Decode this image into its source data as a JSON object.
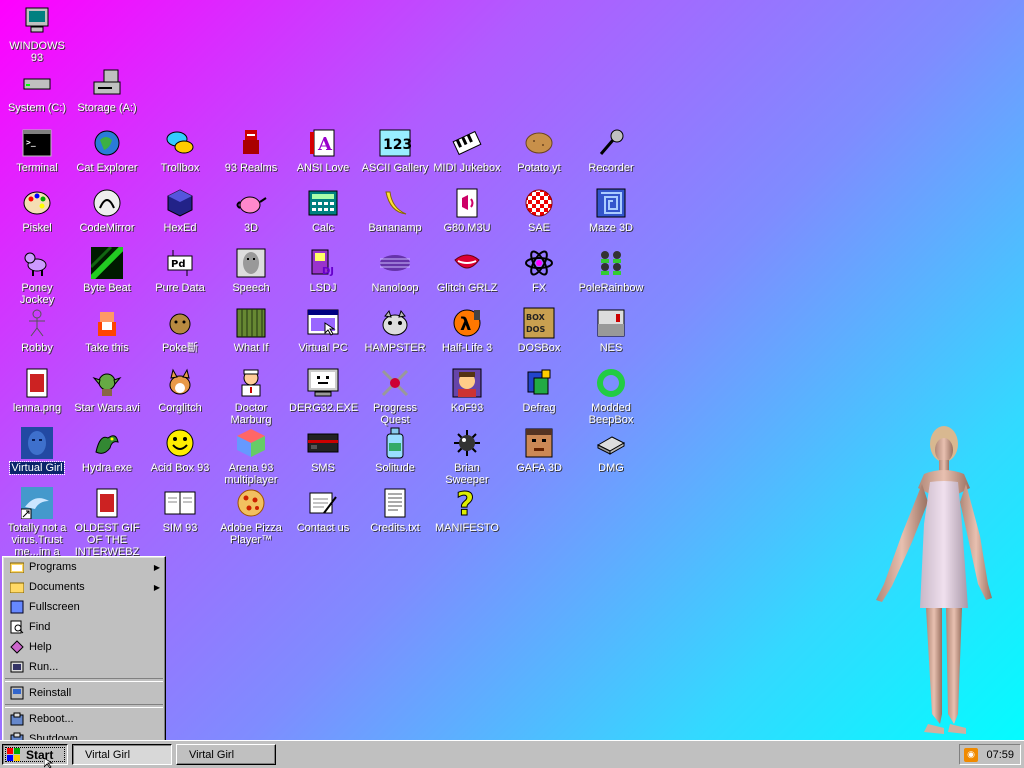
{
  "desktop_icons": {
    "windows93": "WINDOWS 93",
    "system_c": "System (C:)",
    "storage_a": "Storage (A:)",
    "terminal": "Terminal",
    "cat_explorer": "Cat Explorer",
    "trollbox": "Trollbox",
    "realms93": "93 Realms",
    "ansi_love": "ANSI Love",
    "ascii_gallery": "ASCII Gallery",
    "midi_jukebox": "MIDI Jukebox",
    "potato_yt": "Potato.yt",
    "recorder": "Recorder",
    "piskel": "Piskel",
    "codemirror": "CodeMirror",
    "hexed": "HexEd",
    "threed": "3D",
    "calc": "Calc",
    "bananamp": "Bananamp",
    "g80m3u": "G80.M3U",
    "sae": "SAE",
    "maze3d": "Maze 3D",
    "poney_jockey": "Poney Jockey",
    "byte_beat": "Byte Beat",
    "pure_data": "Pure Data",
    "speech": "Speech",
    "lsdj": "LSDJ",
    "nanoloop": "Nanoloop",
    "glitch_grlz": "Glitch GRLZ",
    "fx": "FX",
    "polerainbow": "PoleRainbow",
    "robby": "Robby",
    "take_this": "Take this",
    "pokemon": "Poke斷",
    "what_if": "What If",
    "virtual_pc": "Virtual PC",
    "hampster": "HAMPSTER",
    "halflife3": "Half-Life 3",
    "dosbox": "DOSBox",
    "nes": "NES",
    "lenna": "lenna.png",
    "star_wars": "Star Wars.avi",
    "corglitch": "Corglitch",
    "doctor_marburg": "Doctor Marburg",
    "derg32": "DERG32.EXE",
    "progress_quest": "Progress Quest",
    "kof93": "KoF93",
    "defrag": "Defrag",
    "modded_beepbox": "Modded BeepBox",
    "virtual_girl": "Virtual Girl",
    "hydra": "Hydra.exe",
    "acid_box": "Acid Box 93",
    "arena93": "Arena 93 multiplayer",
    "sms": "SMS",
    "solitude": "Solitude",
    "brian_sweeper": "Brian Sweeper",
    "gafa3d": "GAFA 3D",
    "dmg": "DMG",
    "totally_not_virus": "Totally not a virus.Trust me...im a",
    "oldest_gif": "OLDEST GIF OF THE INTERWEBZ",
    "sim93": "SIM 93",
    "adobe_pizza": "Adobe Pizza Player™",
    "contact_us": "Contact us",
    "credits": "Credits.txt",
    "manifesto": "MANIFESTO"
  },
  "start_menu": {
    "programs": "Programs",
    "documents": "Documents",
    "fullscreen": "Fullscreen",
    "find": "Find",
    "help": "Help",
    "run": "Run...",
    "reinstall": "Reinstall",
    "reboot": "Reboot...",
    "shutdown": "Shutdown"
  },
  "taskbar": {
    "start_label": "Start",
    "task1": "Virtal Girl",
    "task2": "Virtal Girl",
    "clock": "07:59"
  },
  "colors": {
    "selection": "#0a246a",
    "taskbar": "#c0c0c0"
  }
}
